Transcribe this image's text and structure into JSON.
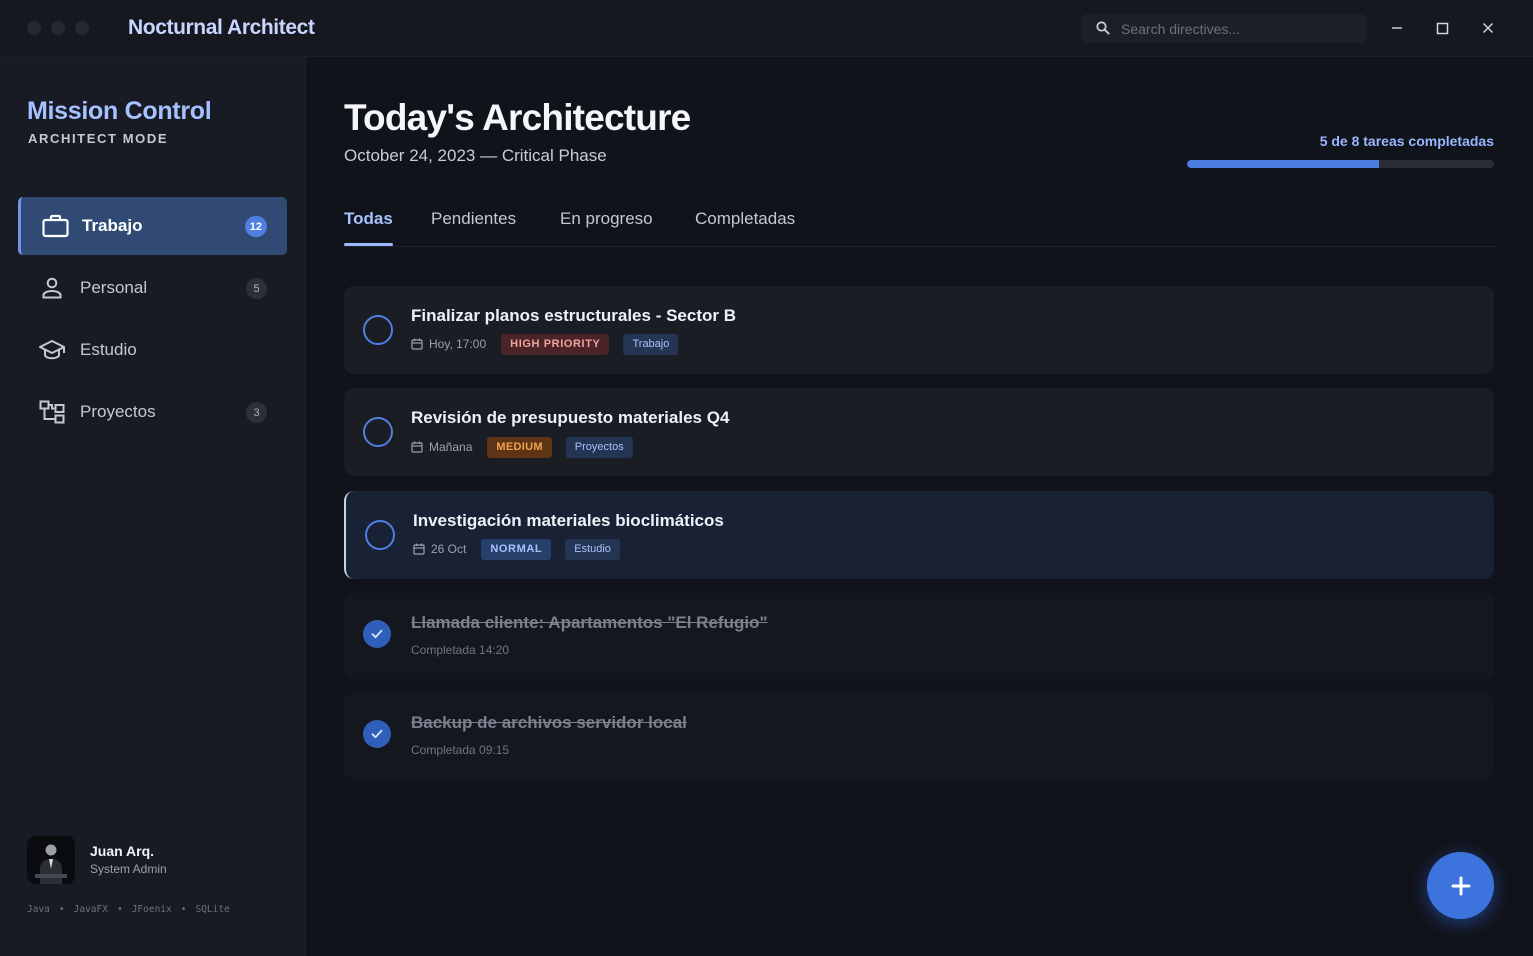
{
  "window": {
    "title": "Nocturnal Architect",
    "search_placeholder": "Search directives..."
  },
  "sidebar": {
    "brand": "Mission Control",
    "mode": "ARCHITECT MODE",
    "items": [
      {
        "label": "Trabajo",
        "count": "12",
        "icon": "briefcase-icon",
        "active": true
      },
      {
        "label": "Personal",
        "count": "5",
        "icon": "person-icon"
      },
      {
        "label": "Estudio",
        "count": "",
        "icon": "graduation-cap-icon"
      },
      {
        "label": "Proyectos",
        "count": "3",
        "icon": "hierarchy-icon"
      }
    ],
    "user": {
      "name": "Juan Arq.",
      "role": "System Admin"
    },
    "tech": [
      "Java",
      "JavaFX",
      "JFoenix",
      "SQLite"
    ]
  },
  "header": {
    "title": "Today's Architecture",
    "subtitle": "October 24, 2023 — Critical Phase",
    "progress_label": "5 de 8 tareas completadas",
    "progress_fraction": 0.625
  },
  "tabs": [
    "Todas",
    "Pendientes",
    "En progreso",
    "Completadas"
  ],
  "tasks": [
    {
      "title": "Finalizar planos estructurales - Sector B",
      "date": "Hoy, 17:00",
      "priority": "HIGH PRIORITY",
      "category": "Trabajo"
    },
    {
      "title": "Revisión de presupuesto materiales Q4",
      "date": "Mañana",
      "priority": "MEDIUM",
      "category": "Proyectos"
    },
    {
      "title": "Investigación materiales bioclimáticos",
      "date": "26 Oct",
      "priority": "NORMAL",
      "category": "Estudio"
    }
  ],
  "done_tasks": [
    {
      "title": "Llamada cliente: Apartamentos \"El Refugio\"",
      "completed": "Completada 14:20"
    },
    {
      "title": "Backup de archivos servidor local",
      "completed": "Completada 09:15"
    }
  ],
  "colors": {
    "accent": "#4f7fe0",
    "high": "#f0a3a0",
    "medium": "#f0a24b",
    "normal": "#a8c2ff"
  }
}
